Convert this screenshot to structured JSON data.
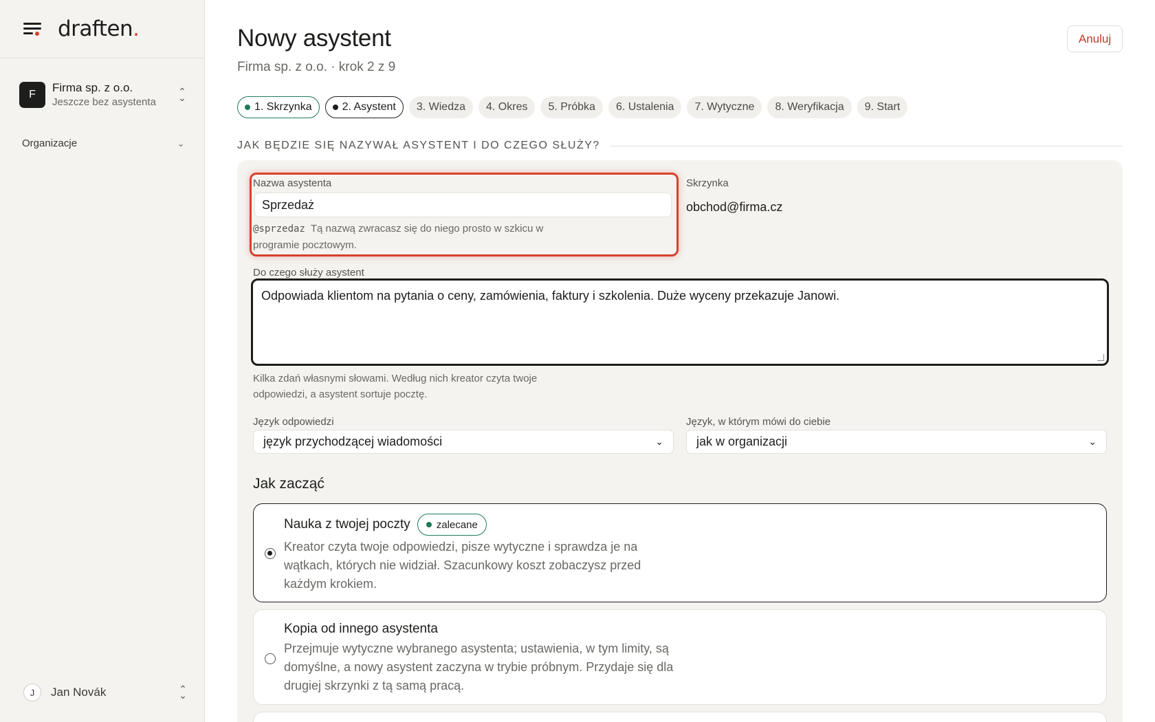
{
  "brand": {
    "logo_text": "draften",
    "logo_dot": "."
  },
  "sidebar": {
    "org": {
      "avatar": "F",
      "name": "Firma sp. z o.o.",
      "status": "Jeszcze bez asystenta"
    },
    "nav_organizations": "Organizacje",
    "user": {
      "avatar": "J",
      "name": "Jan Novák"
    }
  },
  "header": {
    "title": "Nowy asystent",
    "subtitle": "Firma sp. z o.o. · krok 2 z 9",
    "cancel_label": "Anuluj"
  },
  "steps": [
    {
      "label": "1. Skrzynka",
      "state": "done"
    },
    {
      "label": "2. Asystent",
      "state": "active"
    },
    {
      "label": "3. Wiedza",
      "state": "pending"
    },
    {
      "label": "4. Okres",
      "state": "pending"
    },
    {
      "label": "5. Próbka",
      "state": "pending"
    },
    {
      "label": "6. Ustalenia",
      "state": "pending"
    },
    {
      "label": "7. Wytyczne",
      "state": "pending"
    },
    {
      "label": "8. Weryfikacja",
      "state": "pending"
    },
    {
      "label": "9. Start",
      "state": "pending"
    }
  ],
  "section": {
    "heading": "JAK BĘDZIE SIĘ NAZYWAŁ ASYSTENT I DO CZEGO SŁUŻY?",
    "name_field": {
      "label": "Nazwa asystenta",
      "value": "Sprzedaż",
      "handle": "@sprzedaz",
      "hint_line1": "Tą nazwą zwracasz się do niego prosto w szkicu w",
      "hint_line2": "programie pocztowym."
    },
    "mailbox": {
      "label": "Skrzynka",
      "value": "obchod@firma.cz"
    },
    "purpose": {
      "label": "Do czego służy asystent",
      "value": "Odpowiada klientom na pytania o ceny, zamówienia, faktury i szkolenia. Duże wyceny przekazuje Janowi.",
      "hint_line1": "Kilka zdań własnymi słowami. Według nich kreator czyta twoje",
      "hint_line2": "odpowiedzi, a asystent sortuje pocztę."
    },
    "reply_language": {
      "label": "Język odpowiedzi",
      "value": "język przychodzącej wiadomości"
    },
    "ui_language": {
      "label": "Język, w którym mówi do ciebie",
      "value": "jak w organizacji"
    },
    "start": {
      "title": "Jak zacząć",
      "options": [
        {
          "title": "Nauka z twojej poczty",
          "badge": "zalecane",
          "desc1": "Kreator czyta twoje odpowiedzi, pisze wytyczne i sprawdza je na",
          "desc2": "wątkach, których nie widział. Szacunkowy koszt zobaczysz przed",
          "desc3": "każdym krokiem.",
          "selected": true
        },
        {
          "title": "Kopia od innego asystenta",
          "desc1": "Przejmuje wytyczne wybranego asystenta; ustawienia, w tym limity, są",
          "desc2": "domyślne, a nowy asystent zaczyna w trybie próbnym. Przydaje się dla",
          "desc3": "drugiej skrzynki z tą samą pracą.",
          "selected": false
        }
      ]
    }
  },
  "colors": {
    "accent_red": "#d8402c",
    "success_green": "#1f7a56",
    "ink": "#1d1d1b"
  },
  "icons": [
    "menu-icon",
    "chevron-updown-icon",
    "chevron-down-icon",
    "radio-icon"
  ]
}
